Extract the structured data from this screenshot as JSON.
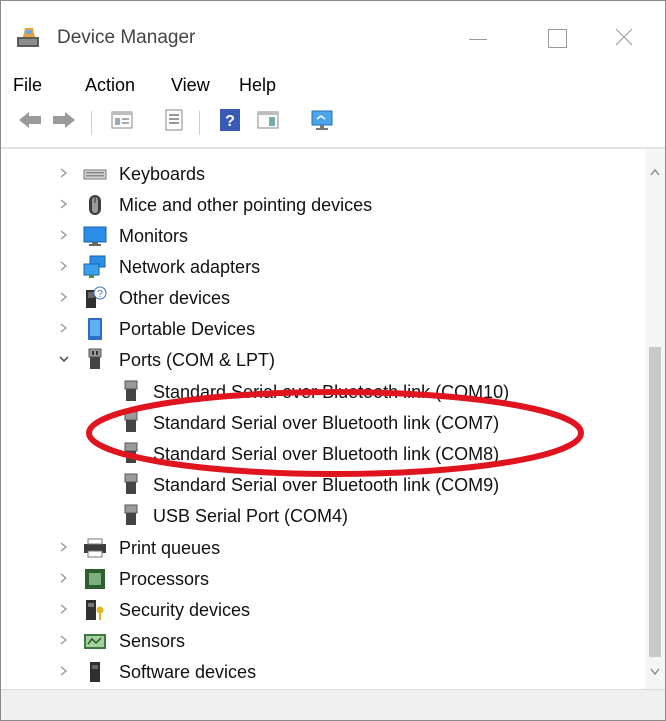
{
  "window": {
    "title": "Device Manager"
  },
  "menu": [
    "File",
    "Action",
    "View",
    "Help"
  ],
  "toolbar": {
    "icons": [
      "back-arrow-icon",
      "forward-arrow-icon",
      "tree-view-icon",
      "properties-icon",
      "help-icon",
      "action-pane-icon",
      "monitor-scan-icon"
    ]
  },
  "tree": {
    "items": [
      {
        "label": "Keyboards",
        "icon": "keyboard-icon",
        "expanded": false
      },
      {
        "label": "Mice and other pointing devices",
        "icon": "mouse-icon",
        "expanded": false
      },
      {
        "label": "Monitors",
        "icon": "monitor-icon",
        "expanded": false
      },
      {
        "label": "Network adapters",
        "icon": "network-icon",
        "expanded": false
      },
      {
        "label": "Other devices",
        "icon": "other-devices-icon",
        "expanded": false
      },
      {
        "label": "Portable Devices",
        "icon": "portable-device-icon",
        "expanded": false
      },
      {
        "label": "Ports (COM & LPT)",
        "icon": "port-icon",
        "expanded": true
      },
      {
        "label": "Standard Serial over Bluetooth link (COM10)",
        "icon": "port-icon",
        "child": true
      },
      {
        "label": "Standard Serial over Bluetooth link (COM7)",
        "icon": "port-icon",
        "child": true
      },
      {
        "label": "Standard Serial over Bluetooth link (COM8)",
        "icon": "port-icon",
        "child": true
      },
      {
        "label": "Standard Serial over Bluetooth link (COM9)",
        "icon": "port-icon",
        "child": true
      },
      {
        "label": "USB Serial Port (COM4)",
        "icon": "port-icon",
        "child": true
      },
      {
        "label": "Print queues",
        "icon": "printer-icon",
        "expanded": false
      },
      {
        "label": "Processors",
        "icon": "processor-icon",
        "expanded": false
      },
      {
        "label": "Security devices",
        "icon": "security-device-icon",
        "expanded": false
      },
      {
        "label": "Sensors",
        "icon": "sensor-icon",
        "expanded": false
      },
      {
        "label": "Software devices",
        "icon": "software-device-icon",
        "expanded": false
      }
    ]
  },
  "colors": {
    "annotation": "#e0141e",
    "accent": "#1f7bd8"
  }
}
